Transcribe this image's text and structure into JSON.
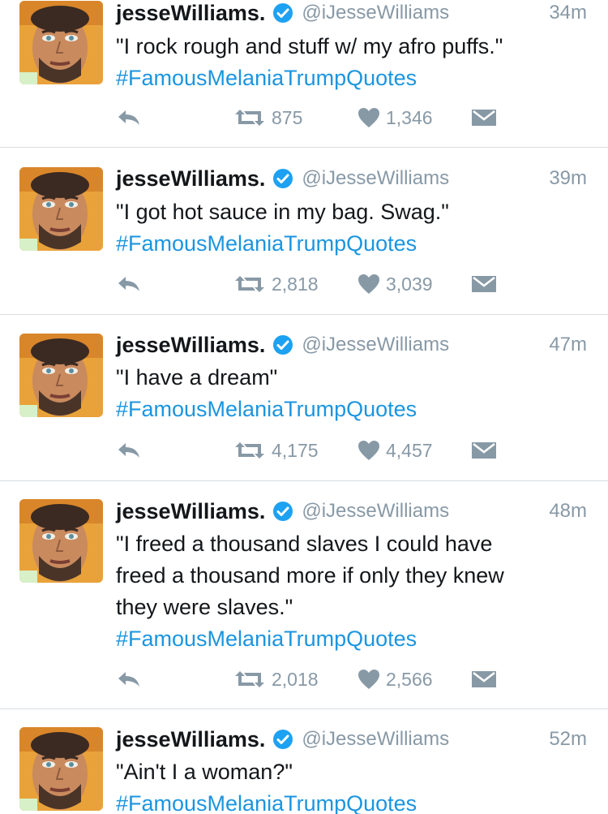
{
  "colors": {
    "link": "#1b95e0",
    "muted": "#8899a6",
    "verified": "#1da1f2",
    "divider": "#d8dde1"
  },
  "tweets": [
    {
      "name": "jesseWilliams.",
      "handle": "@iJesseWilliams",
      "time": "34m",
      "lines": [
        "\"I rock rough and stuff w/ my afro puffs.\""
      ],
      "hashtag": "#FamousMelaniaTrumpQuotes",
      "retweets": "875",
      "likes": "1,346"
    },
    {
      "name": "jesseWilliams.",
      "handle": "@iJesseWilliams",
      "time": "39m",
      "lines": [
        "\"I got hot sauce in my bag. Swag.\""
      ],
      "hashtag": "#FamousMelaniaTrumpQuotes",
      "retweets": "2,818",
      "likes": "3,039"
    },
    {
      "name": "jesseWilliams.",
      "handle": "@iJesseWilliams",
      "time": "47m",
      "lines": [
        "\"I have a dream\""
      ],
      "hashtag": "#FamousMelaniaTrumpQuotes",
      "retweets": "4,175",
      "likes": "4,457"
    },
    {
      "name": "jesseWilliams.",
      "handle": "@iJesseWilliams",
      "time": "48m",
      "lines": [
        "\"I freed a thousand slaves I could have",
        "freed a thousand more if only they knew",
        "they were slaves.\""
      ],
      "hashtag": "#FamousMelaniaTrumpQuotes",
      "retweets": "2,018",
      "likes": "2,566"
    },
    {
      "name": "jesseWilliams.",
      "handle": "@iJesseWilliams",
      "time": "52m",
      "lines": [
        "\"Ain't I a woman?\""
      ],
      "hashtag": "#FamousMelaniaTrumpQuotes"
    }
  ]
}
